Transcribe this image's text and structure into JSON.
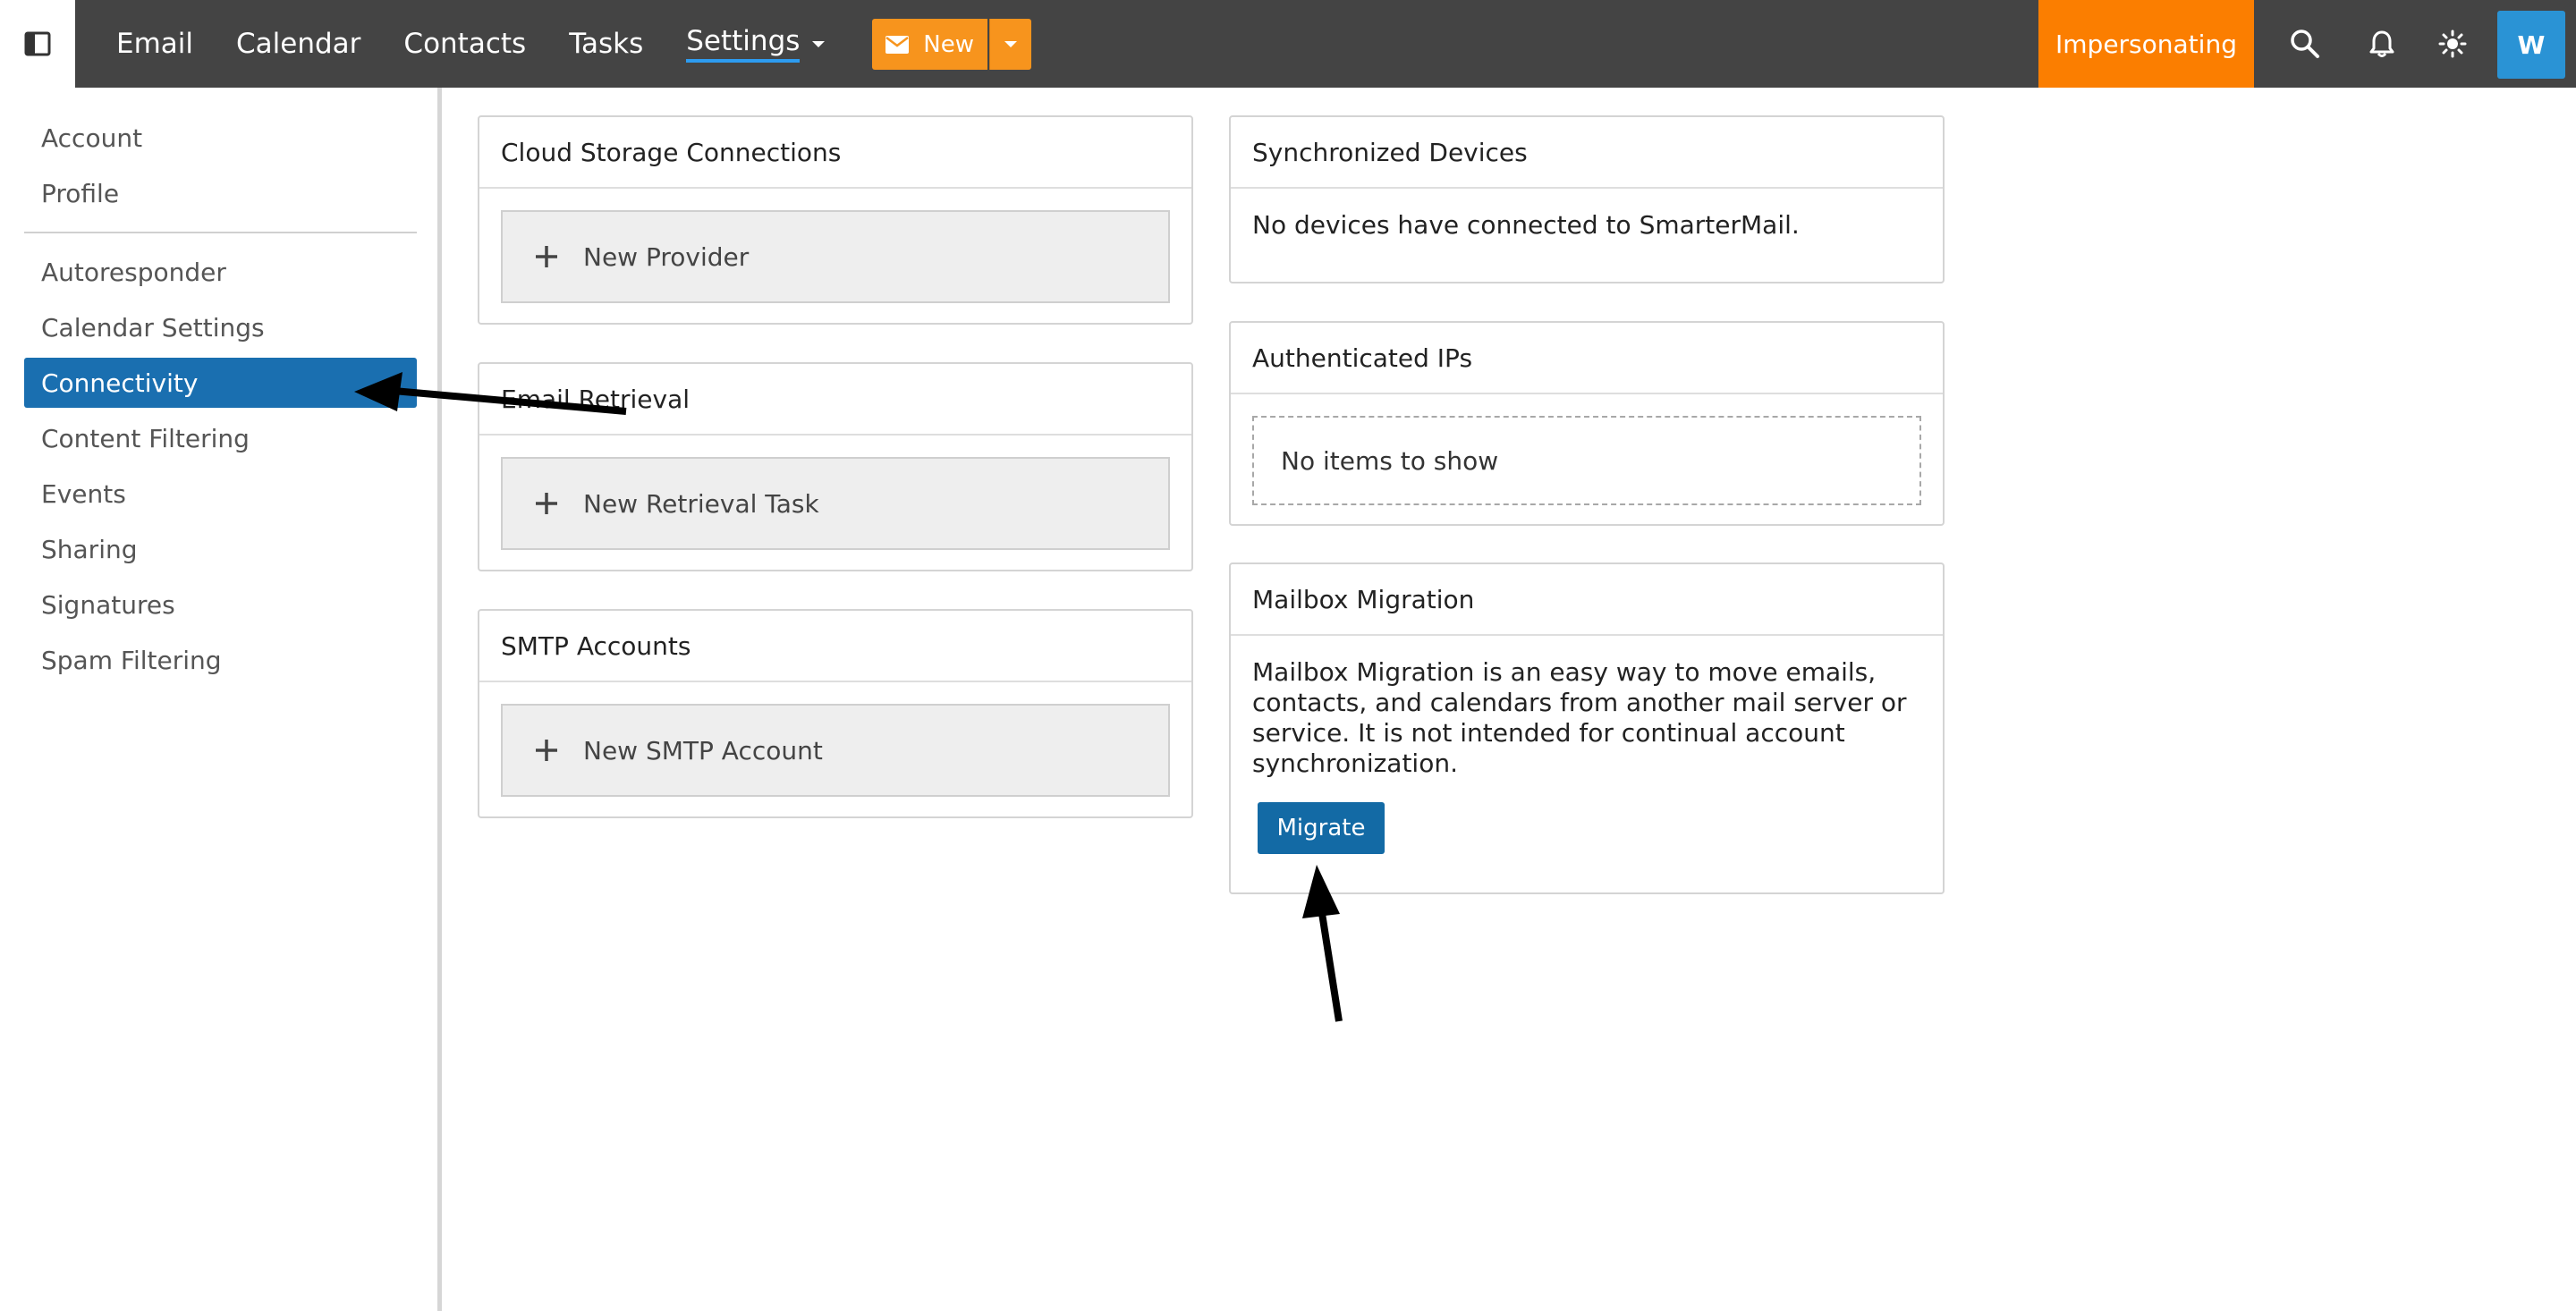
{
  "topbar": {
    "nav": [
      {
        "label": "Email"
      },
      {
        "label": "Calendar"
      },
      {
        "label": "Contacts"
      },
      {
        "label": "Tasks"
      }
    ],
    "settings_label": "Settings",
    "new_label": "New",
    "impersonating_label": "Impersonating",
    "avatar_initial": "W",
    "accent_color": "#f7941d",
    "impersonating_color": "#fb7e00",
    "icons": [
      "sidebar-toggle-icon",
      "mail-icon",
      "search-icon",
      "bell-icon",
      "sun-icon"
    ]
  },
  "sidebar": {
    "items": [
      {
        "label": "Account"
      },
      {
        "label": "Profile"
      },
      {
        "label": "Autoresponder"
      },
      {
        "label": "Calendar Settings"
      },
      {
        "label": "Connectivity",
        "active": true
      },
      {
        "label": "Content Filtering"
      },
      {
        "label": "Events"
      },
      {
        "label": "Sharing"
      },
      {
        "label": "Signatures"
      },
      {
        "label": "Spam Filtering"
      }
    ],
    "active_color": "#1a6fb0"
  },
  "cards": {
    "cloud_storage": {
      "title": "Cloud Storage Connections",
      "button": "New Provider"
    },
    "email_retrieval": {
      "title": "Email Retrieval",
      "button": "New Retrieval Task"
    },
    "smtp_accounts": {
      "title": "SMTP Accounts",
      "button": "New SMTP Account"
    },
    "synchronized_devices": {
      "title": "Synchronized Devices",
      "text": "No devices have connected to SmarterMail."
    },
    "authenticated_ips": {
      "title": "Authenticated IPs",
      "empty_text": "No items to show"
    },
    "mailbox_migration": {
      "title": "Mailbox Migration",
      "description": "Mailbox Migration is an easy way to move emails, contacts, and calendars from another mail server or service. It is not intended for continual account synchronization.",
      "button": "Migrate"
    }
  }
}
